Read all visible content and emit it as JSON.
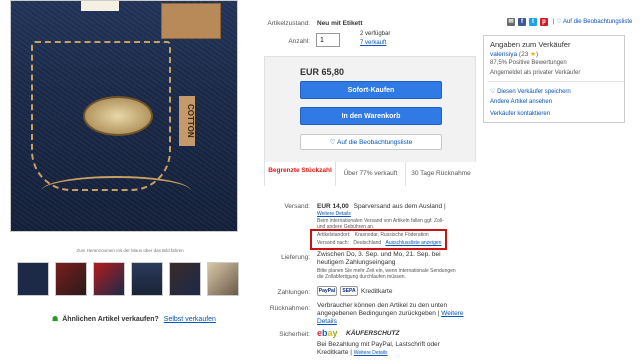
{
  "photo": {
    "tag_text": "COTTON",
    "hover_hint": "Zum Heranzoomen mit der Maus über das Bild fahren"
  },
  "similar": {
    "text": "Ähnlichen Artikel verkaufen?",
    "link": "Selbst verkaufen"
  },
  "item": {
    "condition_label": "Artikelzustand:",
    "condition_value": "Neu mit Etikett",
    "quantity_label": "Anzahl:",
    "quantity_value": "1",
    "available": "2 verfügbar",
    "sold": "7 verkauft"
  },
  "buybox": {
    "price": "EUR 65,80",
    "buy_now": "Sofort-Kaufen",
    "add_to_cart": "In den Warenkorb",
    "watchlist": "Auf die Beobachtungsliste",
    "features": [
      {
        "text": "Begrenzte Stückzahl"
      },
      {
        "text": "Über 77% verkauft"
      },
      {
        "text": "30 Tage Rücknahme"
      }
    ]
  },
  "shipping": {
    "label": "Versand:",
    "price": "EUR 14,00",
    "method": "Sparversand aus dem Ausland |",
    "details_link": "Weitere Details",
    "intl_note": "Beim internationalen Versand von Artikeln fallen ggf. Zoll- und andere Gebühren an.",
    "location_label": "Artikelstandort:",
    "location_value": "Krasnodar, Russische Föderation",
    "ships_to_label": "Versand nach:",
    "ships_to_value": "Deutschland",
    "exclusions_link": "Ausschlussliste anzeigen"
  },
  "delivery": {
    "label": "Lieferung:",
    "text": "Zwischen Do, 3. Sep. und Mo, 21. Sep. bei heutigem Zahlungseingang",
    "note": "Bitte planen Sie mehr Zeit ein, wenn internationale Sendungen die Zollabfertigung durchlaufen müssen."
  },
  "payment": {
    "label": "Zahlungen:",
    "paypal": "PayPal",
    "sepa": "SEPA",
    "card": "Kreditkarte"
  },
  "returns": {
    "label": "Rücknahmen:",
    "text": "Verbraucher können den Artikel zu den unten angegebenen Bedingungen zurückgeben |",
    "link": "Weitere Details"
  },
  "security": {
    "label": "Sicherheit:",
    "brand": "ebay",
    "protection": "KÄUFERSCHUTZ",
    "text": "Bei Bezahlung mit PayPal, Lastschrift oder Kreditkarte |",
    "link": "Weitere Details"
  },
  "share": {
    "watchlist": "Auf die Beobachtungsliste"
  },
  "seller": {
    "title": "Angaben zum Verkäufer",
    "name": "valensiya",
    "rating": "(23",
    "positive": "87,5% Positive Bewertungen",
    "type": "Angemeldet als privater Verkäufer",
    "save_seller": "Diesen Verkäufer speichern",
    "other_items": "Andere Artikel ansehen",
    "contact": "Verkäufer kontaktieren"
  },
  "colors": {
    "accent": "#2f7ae5",
    "link": "#0654ba",
    "alert": "#e3140f"
  }
}
